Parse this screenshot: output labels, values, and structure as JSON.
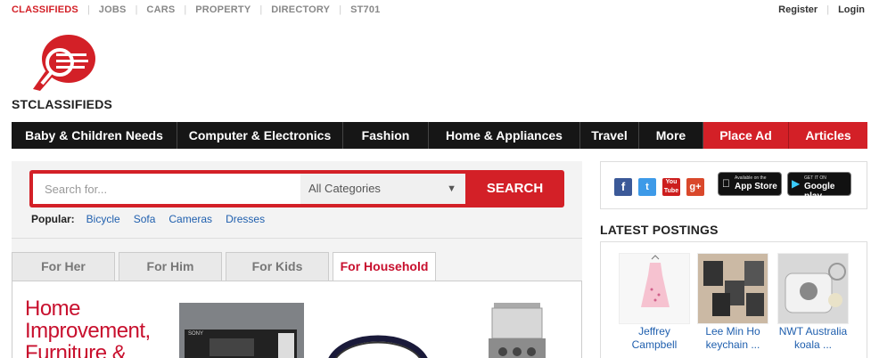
{
  "topbar": {
    "links": [
      "CLASSIFIEDS",
      "JOBS",
      "CARS",
      "PROPERTY",
      "DIRECTORY",
      "ST701"
    ],
    "register": "Register",
    "login": "Login"
  },
  "logo": {
    "brand_st": "ST",
    "brand_rest": "CLASSIFIEDS"
  },
  "nav": {
    "items": [
      "Baby & Children Needs",
      "Computer & Electronics",
      "Fashion",
      "Home & Appliances",
      "Travel",
      "More"
    ],
    "place_ad": "Place Ad",
    "articles": "Articles"
  },
  "search": {
    "placeholder": "Search for...",
    "category": "All Categories",
    "button": "SEARCH"
  },
  "popular": {
    "label": "Popular:",
    "tags": [
      "Bicycle",
      "Sofa",
      "Cameras",
      "Dresses"
    ]
  },
  "tabs": [
    "For Her",
    "For Him",
    "For Kids",
    "For Household"
  ],
  "tabpanel": {
    "headline_lines": [
      "Home",
      "Improvement,",
      "Furniture &"
    ],
    "product1_label": "SONY"
  },
  "social": {
    "apple_small": "Available on the",
    "apple_big": "App Store",
    "google_small": "GET IT ON",
    "google_big": "Google play"
  },
  "latest": {
    "title": "LATEST POSTINGS",
    "posts": [
      {
        "caption_1": "Jeffrey",
        "caption_2": "Campbell"
      },
      {
        "caption_1": "Lee Min Ho",
        "caption_2": "keychain ..."
      },
      {
        "caption_1": "NWT Australia",
        "caption_2": "koala ..."
      }
    ]
  },
  "colors": {
    "brand_red": "#d32027",
    "nav_black": "#161616",
    "link_blue": "#1f5fae",
    "tab_active": "#c8102e"
  }
}
